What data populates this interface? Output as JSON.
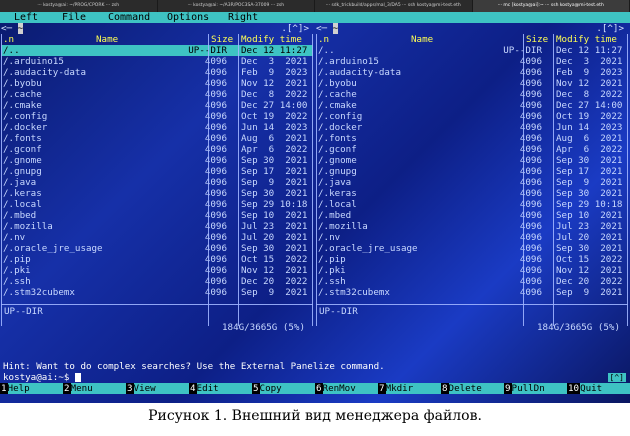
{
  "tabs": [
    "··· kostya@ai: ~/PROG/CPORK ··· zsh",
    "··· kostya@ai: ~/A3R/POC3SA-37009 ··· zsh",
    "··· sdk_trickbuild/apps/mal_3/DA5 ··· ssh kostya@mi-test.eth",
    "··· mc [kostya@ai]:~ ··· ssh kostya@mi-test.eth"
  ],
  "menu": {
    "left": "Left",
    "file": "File",
    "command": "Command",
    "options": "Options",
    "right": "Right"
  },
  "left_panel": {
    "path": "~",
    "header_marks": ".[^]>",
    "col_n": ".n",
    "col_name": "Name",
    "col_size": "Size",
    "col_mtime": "Modify time",
    "rows": [
      {
        "name": "/..",
        "size": "UP--DIR",
        "mtime": "Dec 12 11:27"
      },
      {
        "name": "/.arduino15",
        "size": "4096",
        "mtime": "Dec  3  2021"
      },
      {
        "name": "/.audacity-data",
        "size": "4096",
        "mtime": "Feb  9  2023"
      },
      {
        "name": "/.byobu",
        "size": "4096",
        "mtime": "Nov 12  2021"
      },
      {
        "name": "/.cache",
        "size": "4096",
        "mtime": "Dec  8  2022"
      },
      {
        "name": "/.cmake",
        "size": "4096",
        "mtime": "Dec 27 14:00"
      },
      {
        "name": "/.config",
        "size": "4096",
        "mtime": "Oct 19  2022"
      },
      {
        "name": "/.docker",
        "size": "4096",
        "mtime": "Jun 14  2023"
      },
      {
        "name": "/.fonts",
        "size": "4096",
        "mtime": "Aug  6  2021"
      },
      {
        "name": "/.gconf",
        "size": "4096",
        "mtime": "Apr  6  2022"
      },
      {
        "name": "/.gnome",
        "size": "4096",
        "mtime": "Sep 30  2021"
      },
      {
        "name": "/.gnupg",
        "size": "4096",
        "mtime": "Sep 17  2021"
      },
      {
        "name": "/.java",
        "size": "4096",
        "mtime": "Sep  9  2021"
      },
      {
        "name": "/.keras",
        "size": "4096",
        "mtime": "Sep 30  2021"
      },
      {
        "name": "/.local",
        "size": "4096",
        "mtime": "Sep 29 10:18"
      },
      {
        "name": "/.mbed",
        "size": "4096",
        "mtime": "Sep 10  2021"
      },
      {
        "name": "/.mozilla",
        "size": "4096",
        "mtime": "Jul 23  2021"
      },
      {
        "name": "/.nv",
        "size": "4096",
        "mtime": "Jul 20  2021"
      },
      {
        "name": "/.oracle_jre_usage",
        "size": "4096",
        "mtime": "Sep 30  2021"
      },
      {
        "name": "/.pip",
        "size": "4096",
        "mtime": "Oct 15  2022"
      },
      {
        "name": "/.pki",
        "size": "4096",
        "mtime": "Nov 12  2021"
      },
      {
        "name": "/.ssh",
        "size": "4096",
        "mtime": "Dec 20  2022"
      },
      {
        "name": "/.stm32cubemx",
        "size": "4096",
        "mtime": "Sep  9  2021"
      }
    ],
    "mini_status": "UP--DIR",
    "disk": "184G/3665G (5%)"
  },
  "right_panel": {
    "path": "~",
    "header_marks": ".[^]>",
    "col_n": ".n",
    "col_name": "Name",
    "col_size": "Size",
    "col_mtime": "Modify time",
    "rows": [
      {
        "name": "/..",
        "size": "UP--DIR",
        "mtime": "Dec 12 11:27"
      },
      {
        "name": "/.arduino15",
        "size": "4096",
        "mtime": "Dec  3  2021"
      },
      {
        "name": "/.audacity-data",
        "size": "4096",
        "mtime": "Feb  9  2023"
      },
      {
        "name": "/.byobu",
        "size": "4096",
        "mtime": "Nov 12  2021"
      },
      {
        "name": "/.cache",
        "size": "4096",
        "mtime": "Dec  8  2022"
      },
      {
        "name": "/.cmake",
        "size": "4096",
        "mtime": "Dec 27 14:00"
      },
      {
        "name": "/.config",
        "size": "4096",
        "mtime": "Oct 19  2022"
      },
      {
        "name": "/.docker",
        "size": "4096",
        "mtime": "Jun 14  2023"
      },
      {
        "name": "/.fonts",
        "size": "4096",
        "mtime": "Aug  6  2021"
      },
      {
        "name": "/.gconf",
        "size": "4096",
        "mtime": "Apr  6  2022"
      },
      {
        "name": "/.gnome",
        "size": "4096",
        "mtime": "Sep 30  2021"
      },
      {
        "name": "/.gnupg",
        "size": "4096",
        "mtime": "Sep 17  2021"
      },
      {
        "name": "/.java",
        "size": "4096",
        "mtime": "Sep  9  2021"
      },
      {
        "name": "/.keras",
        "size": "4096",
        "mtime": "Sep 30  2021"
      },
      {
        "name": "/.local",
        "size": "4096",
        "mtime": "Sep 29 10:18"
      },
      {
        "name": "/.mbed",
        "size": "4096",
        "mtime": "Sep 10  2021"
      },
      {
        "name": "/.mozilla",
        "size": "4096",
        "mtime": "Jul 23  2021"
      },
      {
        "name": "/.nv",
        "size": "4096",
        "mtime": "Jul 20  2021"
      },
      {
        "name": "/.oracle_jre_usage",
        "size": "4096",
        "mtime": "Sep 30  2021"
      },
      {
        "name": "/.pip",
        "size": "4096",
        "mtime": "Oct 15  2022"
      },
      {
        "name": "/.pki",
        "size": "4096",
        "mtime": "Nov 12  2021"
      },
      {
        "name": "/.ssh",
        "size": "4096",
        "mtime": "Dec 20  2022"
      },
      {
        "name": "/.stm32cubemx",
        "size": "4096",
        "mtime": "Sep  9  2021"
      }
    ],
    "mini_status": "UP--DIR",
    "disk": "184G/3665G (5%)"
  },
  "hint": "Hint: Want to do complex searches? Use the External Panelize command.",
  "prompt": "kostya@ai:~$",
  "indicator": "[^]",
  "fkeys": [
    {
      "n": "1",
      "l": "Help"
    },
    {
      "n": "2",
      "l": "Menu"
    },
    {
      "n": "3",
      "l": "View"
    },
    {
      "n": "4",
      "l": "Edit"
    },
    {
      "n": "5",
      "l": "Copy"
    },
    {
      "n": "6",
      "l": "RenMov"
    },
    {
      "n": "7",
      "l": "Mkdir"
    },
    {
      "n": "8",
      "l": "Delete"
    },
    {
      "n": "9",
      "l": "PullDn"
    },
    {
      "n": "10",
      "l": "Quit"
    }
  ],
  "caption": "Рисунок 1. Внешний вид менеджера файлов.",
  "colors": {
    "cyan": "#3ec3c3",
    "yellow": "#ffff55",
    "bg": "#1630a8"
  }
}
